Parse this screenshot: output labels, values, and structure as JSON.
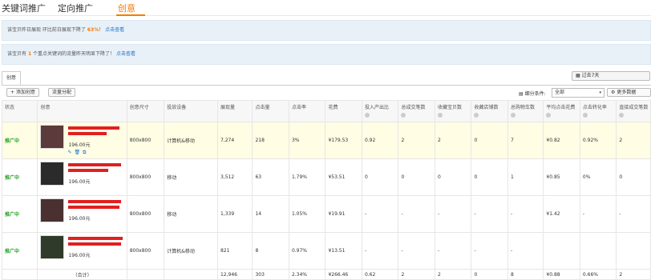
{
  "tabs": [
    "关键词推广",
    "定向推广",
    "创意"
  ],
  "notice1": {
    "text": "该宝贝昨日展现 环比前日展现下降了",
    "pct": "63%",
    "suffix": "！",
    "link": "点击查看"
  },
  "notice2": {
    "text_a": "该宝贝有",
    "count": "1",
    "text_b": "个重点关键词的流量昨天明显下降了！",
    "link": "点击查看"
  },
  "subtab": "创意",
  "date_range": "过去7天",
  "buttons": {
    "add": "添加创意",
    "flow": "流量分配",
    "more": "更多数据"
  },
  "segment": {
    "label": "细分条件:",
    "value": "全部",
    "arrow": "▾"
  },
  "columns": [
    "状态",
    "创意",
    "创意尺寸",
    "投放设备",
    "展现量",
    "点击量",
    "点击率",
    "花费",
    "投入产出比",
    "总成交笔数",
    "收藏宝贝数",
    "收藏店铺数",
    "总购物车数",
    "平均点击花费",
    "点击转化率",
    "直接成交笔数"
  ],
  "rows": [
    {
      "status": "推广中",
      "price": "196.00元",
      "size": "800x800",
      "device": "计算机&移动",
      "imp": "7,274",
      "clk": "218",
      "ctr": "3%",
      "cost": "¥179.53",
      "roi": "0.92",
      "deals": "2",
      "fav_item": "2",
      "fav_shop": "0",
      "cart": "7",
      "cpc": "¥0.82",
      "cvr": "0.92%",
      "direct": "2"
    },
    {
      "status": "推广中",
      "price": "196.00元",
      "size": "800x800",
      "device": "移动",
      "imp": "3,512",
      "clk": "63",
      "ctr": "1.79%",
      "cost": "¥53.51",
      "roi": "0",
      "deals": "0",
      "fav_item": "0",
      "fav_shop": "0",
      "cart": "1",
      "cpc": "¥0.85",
      "cvr": "0%",
      "direct": "0"
    },
    {
      "status": "推广中",
      "price": "196.00元",
      "size": "800x800",
      "device": "移动",
      "imp": "1,339",
      "clk": "14",
      "ctr": "1.05%",
      "cost": "¥19.91",
      "roi": "-",
      "deals": "-",
      "fav_item": "-",
      "fav_shop": "-",
      "cart": "-",
      "cpc": "¥1.42",
      "cvr": "-",
      "direct": "-"
    },
    {
      "status": "推广中",
      "price": "196.00元",
      "size": "800x800",
      "device": "计算机&移动",
      "imp": "821",
      "clk": "8",
      "ctr": "0.97%",
      "cost": "¥13.51",
      "roi": "-",
      "deals": "-",
      "fav_item": "-",
      "fav_shop": "-",
      "cart": "-",
      "cpc": "",
      "cvr": "",
      "direct": ""
    }
  ],
  "total": {
    "label": "（合计）",
    "imp": "12,946",
    "clk": "303",
    "ctr": "2.34%",
    "cost": "¥266.46",
    "roi": "0.62",
    "deals": "2",
    "fav_item": "2",
    "fav_shop": "0",
    "cart": "8",
    "cpc": "¥0.88",
    "cvr": "0.66%",
    "direct": "2"
  },
  "icons": {
    "plus": "+",
    "gear": "⚙",
    "calendar": "▦",
    "filter": "▤",
    "help": "?"
  },
  "colors": {
    "accent": "#f57c00",
    "status_green": "#22a022",
    "link_blue": "#1a73c9",
    "redaction_red": "#e02020"
  }
}
